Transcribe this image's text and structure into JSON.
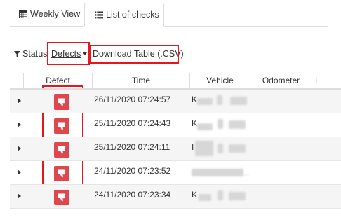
{
  "tabs": [
    {
      "label": "Weekly View",
      "icon": "calendar-icon",
      "active": false
    },
    {
      "label": "List of checks",
      "icon": "list-icon",
      "active": true
    }
  ],
  "filter": {
    "status_label": "Status",
    "status_value": "Defects",
    "download_label": "Download Table (.CSV)"
  },
  "table": {
    "headers": [
      "Defect",
      "Time",
      "Vehicle",
      "Odometer",
      "L"
    ],
    "rows": [
      {
        "defect": true,
        "time": "26/11/2020 07:24:57",
        "vehicle_prefix": "K"
      },
      {
        "defect": true,
        "time": "25/11/2020 07:24:43",
        "vehicle_prefix": "K"
      },
      {
        "defect": true,
        "time": "25/11/2020 07:24:11",
        "vehicle_prefix": "I"
      },
      {
        "defect": true,
        "time": "24/11/2020 07:23:52",
        "vehicle_prefix": ""
      },
      {
        "defect": true,
        "time": "24/11/2020 07:23:34",
        "vehicle_prefix": "K"
      }
    ]
  },
  "colors": {
    "highlight": "#e8151b",
    "defect_badge": "#e0474c",
    "row_alt": "#f5f5f5"
  }
}
